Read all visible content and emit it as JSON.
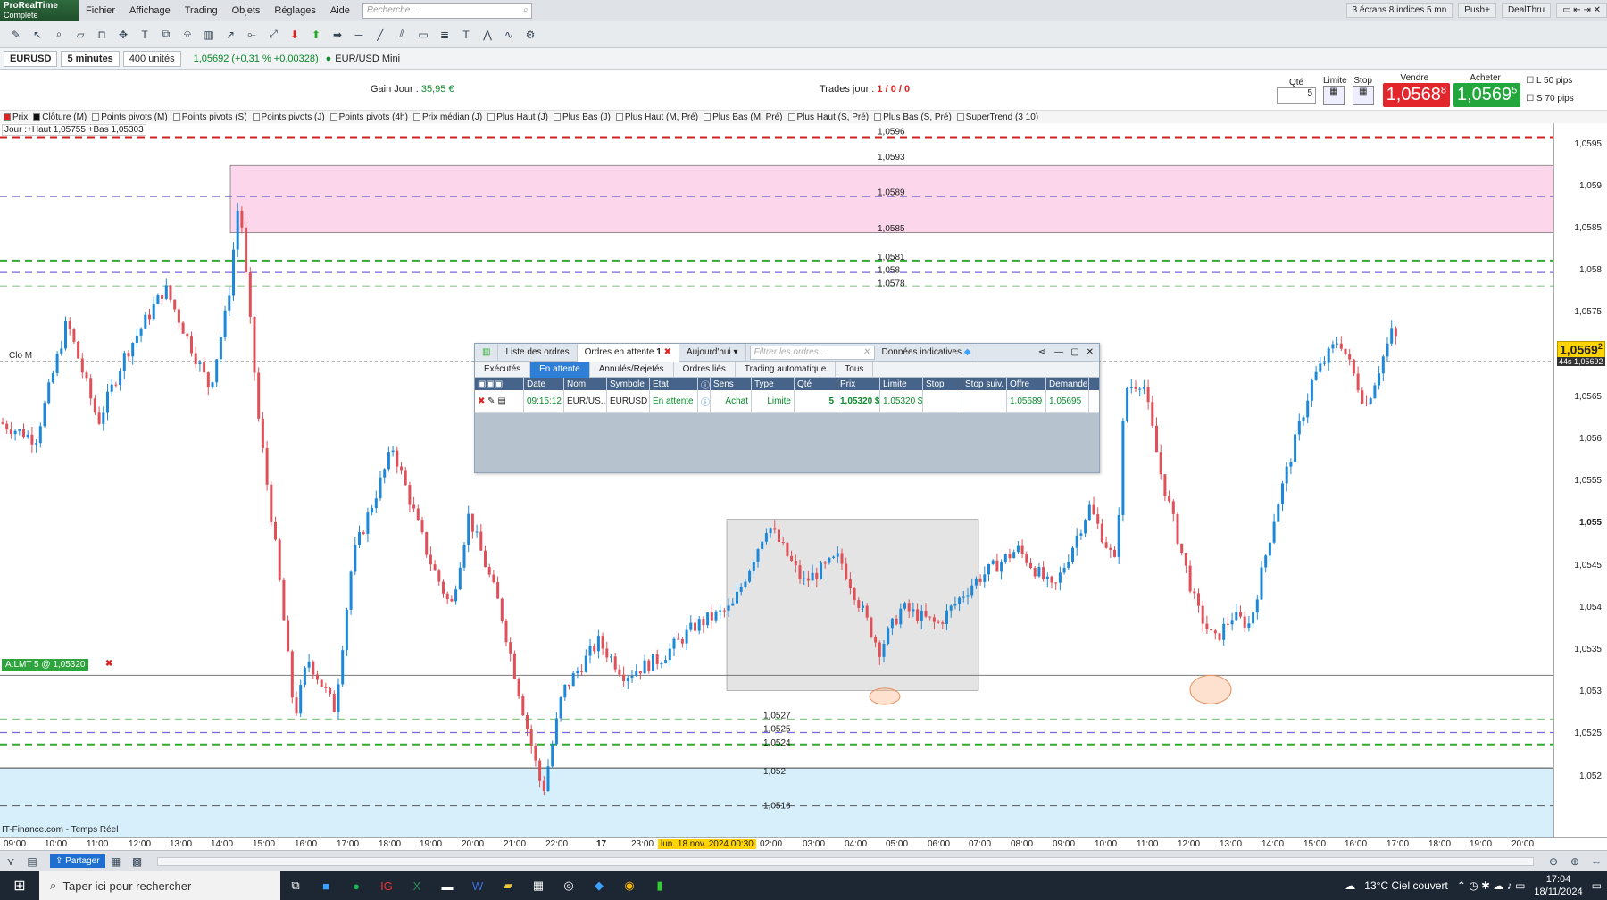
{
  "menubar": {
    "logo_top": "ProRealTime",
    "logo_bottom": "Complete",
    "items": [
      "Fichier",
      "Affichage",
      "Trading",
      "Objets",
      "Réglages",
      "Aide"
    ],
    "search_placeholder": "Recherche ...",
    "right_screens": "3 écrans 8 indices 5 mn",
    "right_push": "Push+",
    "right_dealthru": "DealThru"
  },
  "instrument": {
    "symbol": "EURUSD",
    "period": "5 minutes",
    "units": "400 unités",
    "price_change": "1,05692 (+0,31 % +0,00328)",
    "name": "EUR/USD Mini"
  },
  "info": {
    "gain_label": "Gain Jour :",
    "gain_value": "35,95 €",
    "trades_label": "Trades jour :",
    "trades_value": "1 / 0 / 0"
  },
  "order": {
    "qty_label": "Qté",
    "qty_value": "5",
    "limit_label": "Limite",
    "stop_label": "Stop",
    "sell_label": "Vendre",
    "buy_label": "Acheter",
    "sell_price": "1,0568",
    "sell_sup": "8",
    "buy_price": "1,0569",
    "buy_sup": "5",
    "l_label": "L",
    "l_val": "50",
    "s_label": "S",
    "s_val": "70",
    "pips": "pips"
  },
  "indicators": [
    "Prix",
    "Clôture (M)",
    "Points pivots (M)",
    "Points pivots (S)",
    "Points pivots (J)",
    "Points pivots (4h)",
    "Prix médian (J)",
    "Plus Haut (J)",
    "Plus Bas (J)",
    "Plus Haut (M, Pré)",
    "Plus Bas (M, Pré)",
    "Plus Haut (S, Pré)",
    "Plus Bas (S, Pré)",
    "SuperTrend (3 10)"
  ],
  "chart_meta": {
    "day_info": "Jour :+Haut 1,05755 +Bas 1,05303",
    "clo_label": "Clo M",
    "order_tag": "A:LMT 5 @ 1,05320",
    "source": "IT-Finance.com - Temps Réel",
    "current_price": "1,0569",
    "current_sup": "2",
    "current_time": "44s",
    "current_price_full": "1,05692"
  },
  "levels": {
    "top": [
      "1,0596",
      "1,0593",
      "1,0589",
      "1,0585",
      "1,0581",
      "1,058",
      "1,0578"
    ],
    "bottom": [
      "1,0527",
      "1,0525",
      "1,0524",
      "1,052",
      "1,0516"
    ]
  },
  "price_axis": [
    "1,0595",
    "1,059",
    "1,0585",
    "1,058",
    "1,0575",
    "1,057",
    "1,0565",
    "1,056",
    "1,0555",
    "1,055",
    "1,0545",
    "1,054",
    "1,0535",
    "1,053",
    "1,0525",
    "1,052"
  ],
  "time_axis": [
    "09:00",
    "10:00",
    "11:00",
    "12:00",
    "13:00",
    "14:00",
    "15:00",
    "16:00",
    "17:00",
    "18:00",
    "19:00",
    "20:00",
    "21:00",
    "22:00",
    "17",
    "23:00",
    "lun. 18 nov. 2024 00:30",
    "02:00",
    "03:00",
    "04:00",
    "05:00",
    "06:00",
    "07:00",
    "08:00",
    "09:00",
    "10:00",
    "11:00",
    "12:00",
    "13:00",
    "14:00",
    "15:00",
    "16:00",
    "17:00",
    "18:00",
    "19:00",
    "20:00"
  ],
  "panel": {
    "tabs": [
      "Liste des ordres",
      "Ordres en attente",
      "Aujourd'hui",
      "Données indicatives"
    ],
    "pending_count": "1",
    "filter_placeholder": "Filtrer les ordres ...",
    "subtabs": [
      "Exécutés",
      "En attente",
      "Annulés/Rejetés",
      "Ordres liés",
      "Trading automatique",
      "Tous"
    ],
    "columns": [
      "Date",
      "Nom",
      "Symbole",
      "Etat",
      "Sens",
      "Type",
      "Qté",
      "Prix",
      "Limite",
      "Stop",
      "Stop suiv.",
      "Offre",
      "Demande"
    ],
    "row": {
      "date": "09:15:12",
      "nom": "EUR/US...",
      "symbole": "EURUSD",
      "etat": "En attente",
      "sens": "Achat",
      "type": "Limite",
      "qte": "5",
      "prix": "1,05320 $",
      "limite": "1,05320 $",
      "stop": "",
      "stop_suiv": "",
      "offre": "1,05689",
      "demande": "1,05695"
    }
  },
  "bottombar": {
    "share": "Partager"
  },
  "taskbar": {
    "search": "Taper ici pour rechercher",
    "weather": "13°C  Ciel couvert",
    "time": "17:04",
    "date": "18/11/2024"
  }
}
